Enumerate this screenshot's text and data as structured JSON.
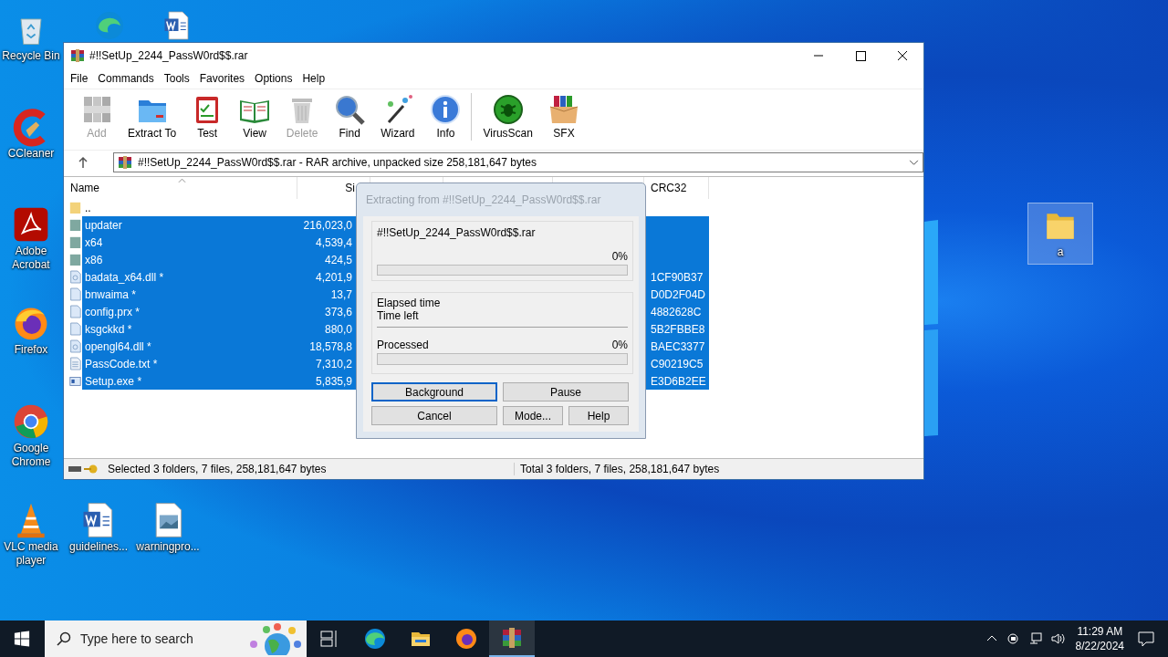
{
  "desktop_icons": [
    {
      "kind": "recycle",
      "label": "Recycle Bin",
      "selected": false
    },
    {
      "kind": "edge",
      "selected": false
    },
    {
      "kind": "word",
      "selected": false
    },
    {
      "kind": "ccleaner",
      "label": "CCleaner",
      "selected": false
    },
    {
      "kind": "acrobat",
      "label": "Adobe Acrobat",
      "selected": false
    },
    {
      "kind": "firefox",
      "label": "Firefox",
      "selected": false
    },
    {
      "kind": "chrome",
      "label": "Google Chrome",
      "selected": false
    },
    {
      "kind": "vlc",
      "label": "VLC media player",
      "selected": false
    },
    {
      "kind": "word",
      "label": "guidelines...",
      "selected": false
    },
    {
      "kind": "image",
      "label": "warningpro...",
      "selected": false
    },
    {
      "kind": "folder",
      "label": "a",
      "selected": true
    }
  ],
  "window": {
    "title": "#!!SetUp_2244_PassW0rd$$.rar",
    "menu": [
      "File",
      "Commands",
      "Tools",
      "Favorites",
      "Options",
      "Help"
    ],
    "toolbar_groups": [
      {
        "items": [
          {
            "kind": "add",
            "label": "Add",
            "disabled": true
          },
          {
            "kind": "extract",
            "label": "Extract To",
            "disabled": false
          },
          {
            "kind": "test",
            "label": "Test",
            "disabled": false
          },
          {
            "kind": "view",
            "label": "View",
            "disabled": false
          },
          {
            "kind": "delete",
            "label": "Delete",
            "disabled": true
          },
          {
            "kind": "find",
            "label": "Find",
            "disabled": false
          },
          {
            "kind": "wizard",
            "label": "Wizard",
            "disabled": false
          },
          {
            "kind": "info",
            "label": "Info",
            "disabled": false
          }
        ]
      },
      {
        "items": [
          {
            "kind": "virus",
            "label": "VirusScan",
            "disabled": false
          },
          {
            "kind": "sfx",
            "label": "SFX",
            "disabled": false
          }
        ]
      }
    ],
    "address": "#!!SetUp_2244_PassW0rd$$.rar - RAR archive, unpacked size 258,181,647 bytes",
    "columns": [
      "Name",
      "Si",
      "CRC32"
    ],
    "rows": [
      {
        "kind": "parent",
        "name": "..",
        "selected": false
      },
      {
        "kind": "folder",
        "name": "updater",
        "size": "216,023,0",
        "selected": true
      },
      {
        "kind": "folder",
        "name": "x64",
        "size": "4,539,4",
        "selected": true
      },
      {
        "kind": "folder",
        "name": "x86",
        "size": "424,5",
        "selected": true
      },
      {
        "kind": "dll",
        "name": "badata_x64.dll *",
        "size": "4,201,9",
        "crc": "1CF90B37",
        "selected": true
      },
      {
        "kind": "file",
        "name": "bnwaima *",
        "size": "13,7",
        "crc": "D0D2F04D",
        "selected": true
      },
      {
        "kind": "file",
        "name": "config.prx *",
        "size": "373,6",
        "crc": "4882628C",
        "selected": true
      },
      {
        "kind": "file",
        "name": "ksgckkd *",
        "size": "880,0",
        "crc": "5B2FBBE8",
        "selected": true
      },
      {
        "kind": "dll",
        "name": "opengl64.dll *",
        "size": "18,578,8",
        "crc": "BAEC3377",
        "selected": true
      },
      {
        "kind": "text",
        "name": "PassCode.txt *",
        "size": "7,310,2",
        "crc": "C90219C5",
        "selected": true
      },
      {
        "kind": "exe",
        "name": "Setup.exe *",
        "size": "5,835,9",
        "crc": "E3D6B2EE",
        "selected": true
      }
    ],
    "status_left": "Selected 3 folders, 7 files, 258,181,647 bytes",
    "status_right": "Total 3 folders, 7 files, 258,181,647 bytes"
  },
  "dialog": {
    "title": "Extracting from #!!SetUp_2244_PassW0rd$$.rar",
    "active": false,
    "archive": "#!!SetUp_2244_PassW0rd$$.rar",
    "archive_progress": {
      "percent": "0%",
      "level": 0
    },
    "time_labels": [
      "Elapsed time",
      "Time left"
    ],
    "processed": "Processed",
    "processed_progress": {
      "percent": "0%",
      "level": 0
    },
    "buttons": [
      {
        "label": "Background",
        "focused": true
      },
      {
        "label": "Pause",
        "focused": false
      },
      {
        "label": "Cancel",
        "focused": false
      },
      {
        "label": "Mode...",
        "focused": false
      },
      {
        "label": "Help",
        "focused": false
      }
    ]
  },
  "taskbar": {
    "search_placeholder": "Type here to search",
    "apps": [
      {
        "kind": "taskview",
        "active": false
      },
      {
        "kind": "edge",
        "active": false
      },
      {
        "kind": "explorer",
        "active": false
      },
      {
        "kind": "firefox",
        "active": false
      },
      {
        "kind": "winrar",
        "active": true
      }
    ],
    "time": "11:29 AM",
    "date": "8/22/2024"
  }
}
